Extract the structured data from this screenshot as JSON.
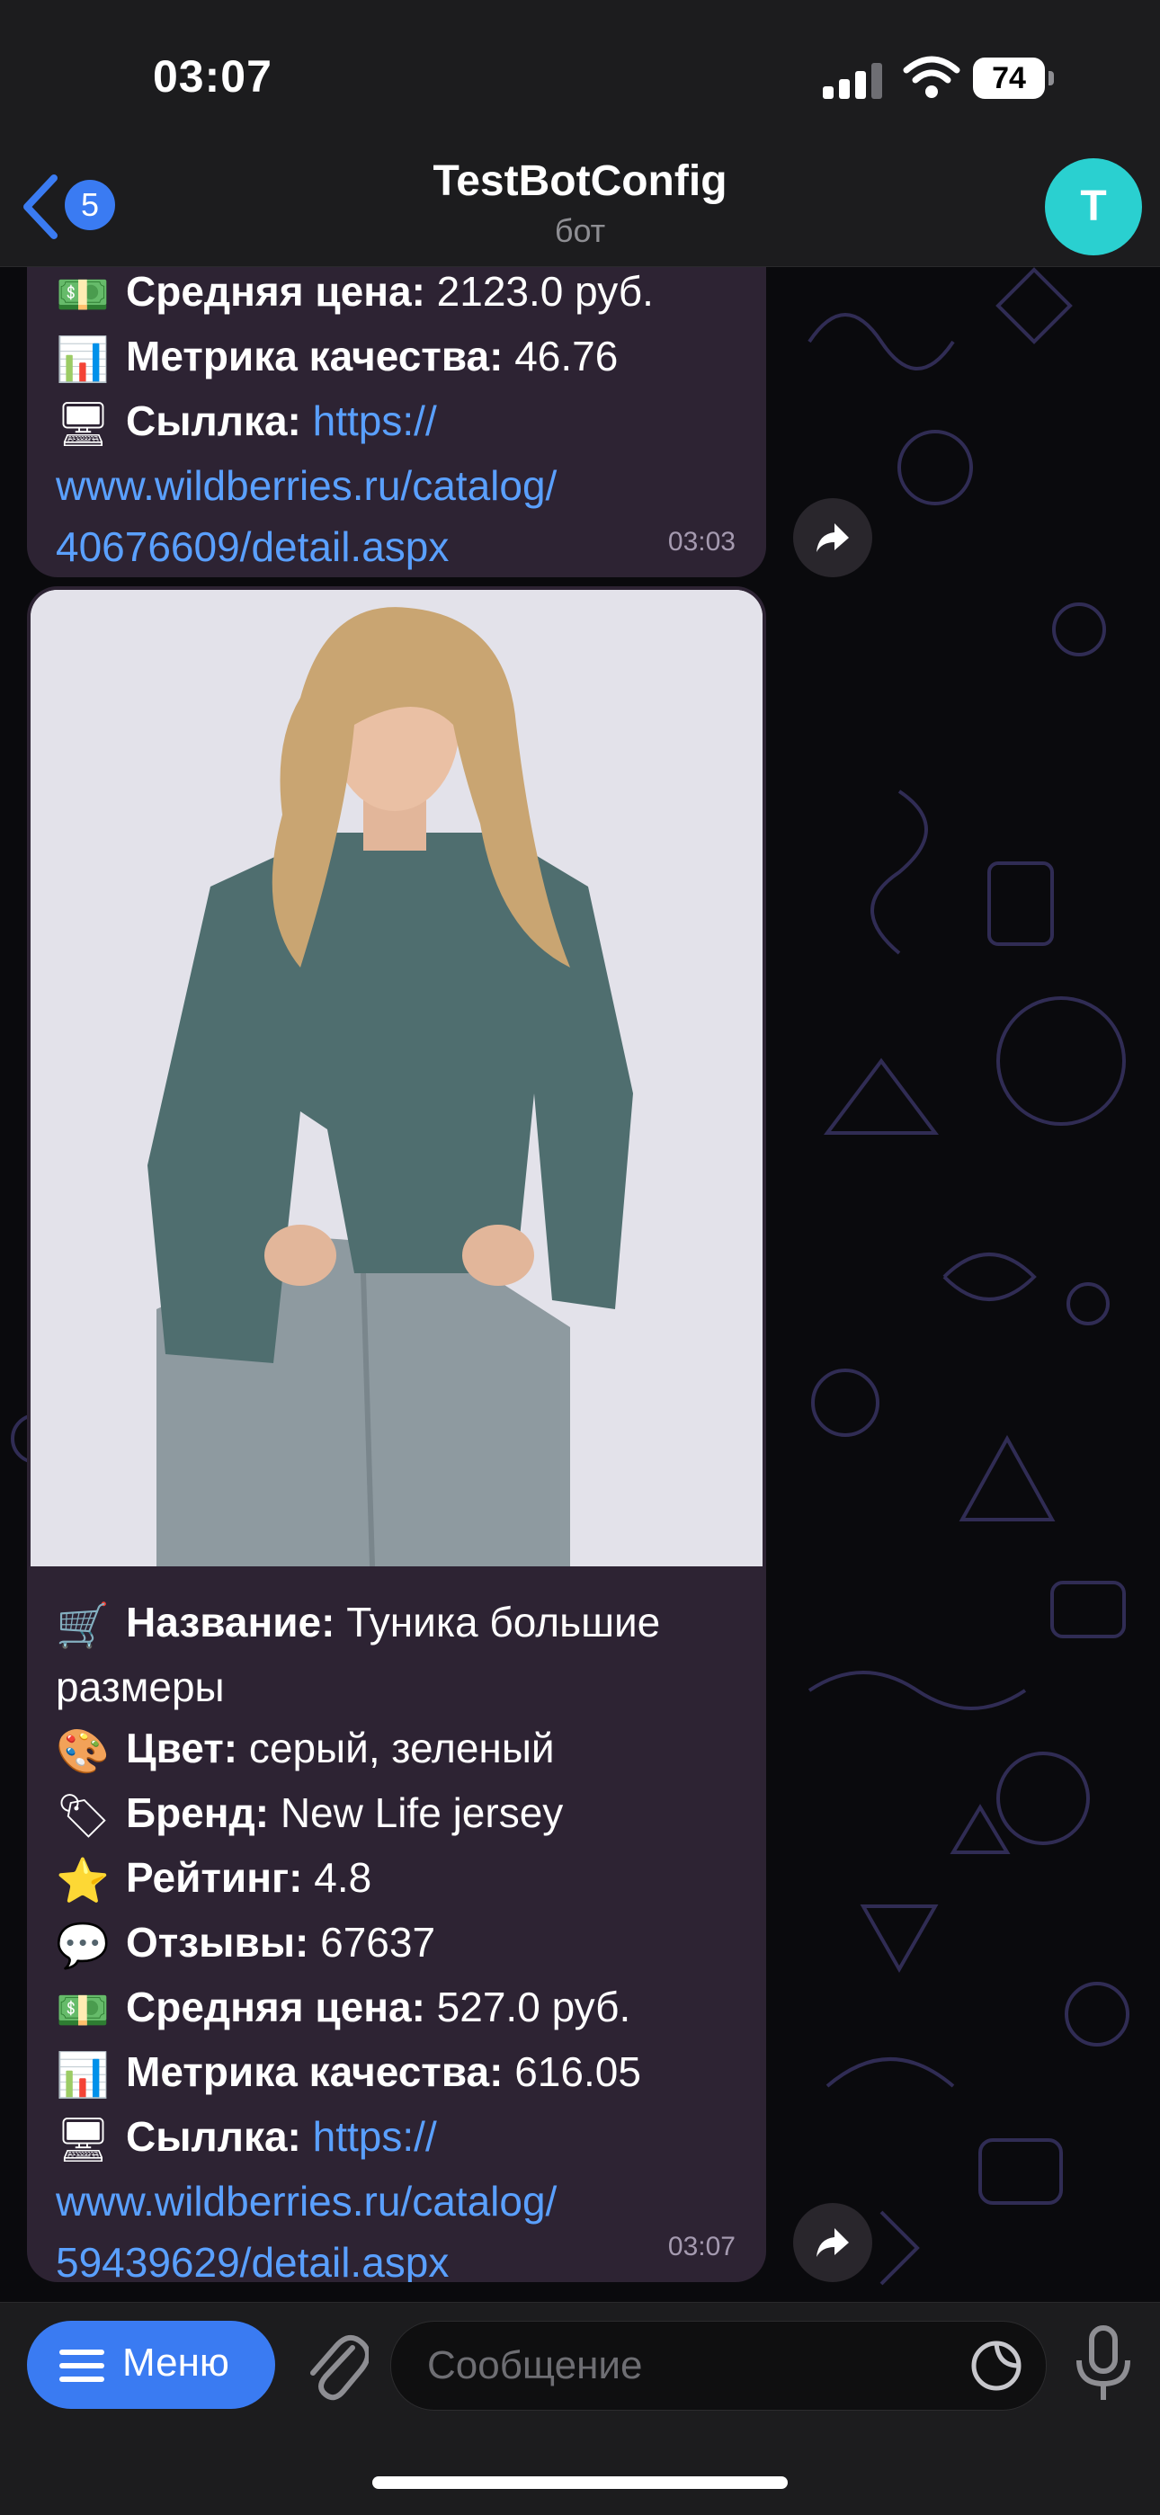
{
  "status_bar": {
    "time": "03:07",
    "battery": "74"
  },
  "header": {
    "back_badge": "5",
    "title": "TestBotConfig",
    "subtitle": "бот",
    "avatar_letter": "T"
  },
  "messages": [
    {
      "lines": [
        {
          "emoji": "💵",
          "label": "Средняя цена:",
          "value": " 2123.0 руб."
        },
        {
          "emoji": "📊",
          "label": "Метрика качества:",
          "value": " 46.76"
        }
      ],
      "link_label": "Сыллка:",
      "link_emoji": "🖥",
      "link_parts": [
        "https://",
        "www.wildberries.ru/catalog/",
        "40676609/detail.aspx"
      ],
      "time": "03:03"
    },
    {
      "lines": [
        {
          "emoji": "🛒",
          "label": "Название:",
          "value": " Туника большие размеры"
        },
        {
          "emoji": "🎨",
          "label": "Цвет:",
          "value": " серый, зеленый"
        },
        {
          "emoji": "🏷",
          "label": "Бренд:",
          "value": " New Life jersey"
        },
        {
          "emoji": "⭐",
          "label": "Рейтинг:",
          "value": " 4.8"
        },
        {
          "emoji": "💬",
          "label": "Отзывы:",
          "value": " 67637"
        },
        {
          "emoji": "💵",
          "label": "Средняя цена:",
          "value": " 527.0 руб."
        },
        {
          "emoji": "📊",
          "label": "Метрика качества:",
          "value": " 616.05"
        }
      ],
      "link_label": "Сыллка:",
      "link_emoji": "🖥",
      "link_parts": [
        "https://",
        "www.wildberries.ru/catalog/",
        "59439629/detail.aspx"
      ],
      "time": "03:07"
    }
  ],
  "input_bar": {
    "menu_label": "Меню",
    "placeholder": "Сообщение"
  },
  "colors": {
    "accent": "#3a7bf2",
    "bubble": "#2d2333",
    "link": "#5aa0ff",
    "avatar": "#2ad0d0"
  }
}
